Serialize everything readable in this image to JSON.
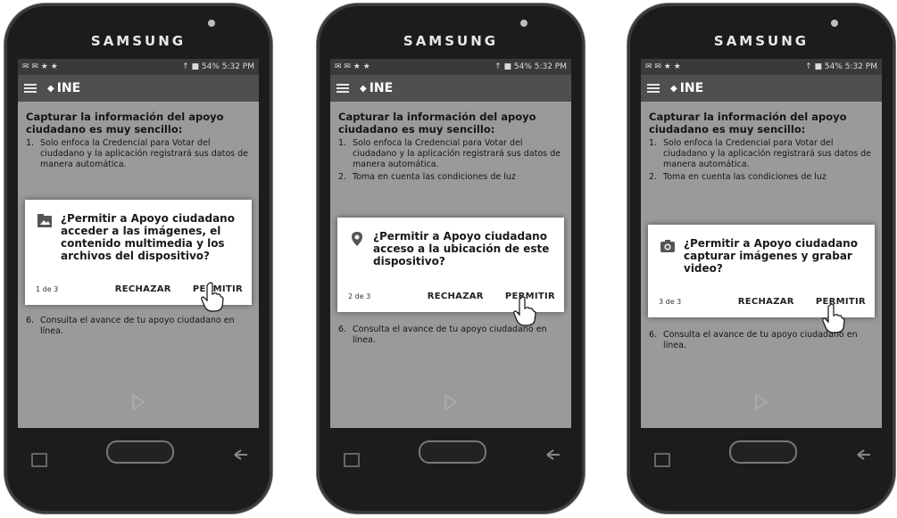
{
  "phones": [
    {
      "brand": "SAMSUNG",
      "status_left": "✉ ✉ ★ ★",
      "status_right": "↑ ■ 54% 5:32 PM",
      "logo": "INE",
      "intro": "Capturar la información del apoyo ciudadano es muy sencillo:",
      "step1_num": "1.",
      "step1": "Solo enfoca la Credencial para Votar del ciudadano y la aplicación registrará sus datos de manera automática.",
      "dialog_icon": "image-folder-icon",
      "dialog_message": "¿Permitir a Apoyo ciudadano acceder a las imágenes, el contenido multimedia y los archivos del dispositivo?",
      "counter": "1 de 3",
      "deny": "RECHAZAR",
      "allow": "PERMITIR",
      "step6_num": "6.",
      "step6": "Consulta el avance de tu apoyo ciudadano en línea."
    },
    {
      "brand": "SAMSUNG",
      "status_left": "✉ ✉ ★ ★",
      "status_right": "↑ ■ 54% 5:32 PM",
      "logo": "INE",
      "intro": "Capturar la información del apoyo ciudadano es muy sencillo:",
      "step1_num": "1.",
      "step1": "Solo enfoca la Credencial para Votar del ciudadano y la aplicación registrará sus datos de manera automática.",
      "step2_num": "2.",
      "step2": "Toma en cuenta las condiciones de luz",
      "dialog_icon": "location-pin-icon",
      "dialog_message": "¿Permitir a Apoyo ciudadano acceso a la ubicación de este dispositivo?",
      "counter": "2 de 3",
      "deny": "RECHAZAR",
      "allow": "PERMITIR",
      "step6_num": "6.",
      "step6": "Consulta el avance de tu apoyo ciudadano en línea."
    },
    {
      "brand": "SAMSUNG",
      "status_left": "✉ ✉ ★ ★",
      "status_right": "↑ ■ 54% 5:32 PM",
      "logo": "INE",
      "intro": "Capturar la información del apoyo ciudadano es muy sencillo:",
      "step1_num": "1.",
      "step1": "Solo enfoca la Credencial para Votar del ciudadano y la aplicación registrará sus datos de manera automática.",
      "step2_num": "2.",
      "step2": "Toma en cuenta las condiciones de luz",
      "dialog_icon": "camera-icon",
      "dialog_message": "¿Permitir a Apoyo ciudadano capturar imágenes y grabar video?",
      "counter": "3 de 3",
      "deny": "RECHAZAR",
      "allow": "PERMITIR",
      "step6_num": "6.",
      "step6": "Consulta el avance de tu apoyo ciudadano en línea."
    }
  ]
}
